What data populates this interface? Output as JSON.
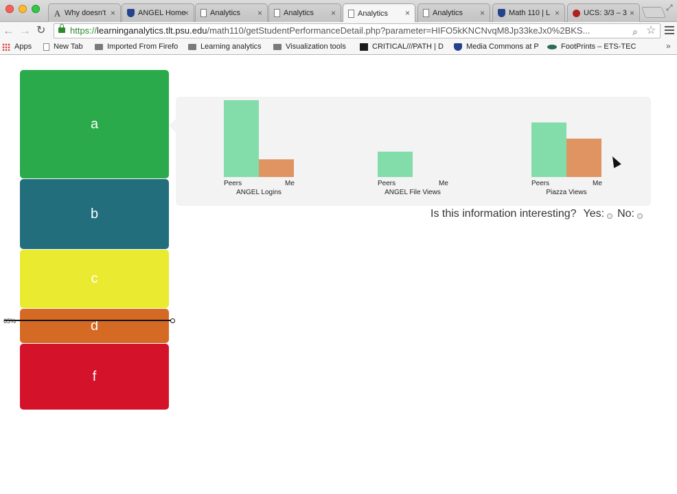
{
  "browser": {
    "tabs": [
      {
        "label": "Why doesn't",
        "icon": "letter-a-icon",
        "close": "×"
      },
      {
        "label": "ANGEL Home",
        "icon": "shield-icon",
        "close": "×"
      },
      {
        "label": "Analytics",
        "icon": "page-icon",
        "close": "×"
      },
      {
        "label": "Analytics",
        "icon": "page-icon",
        "close": "×"
      },
      {
        "label": "Analytics",
        "icon": "page-icon",
        "close": "×",
        "active": true
      },
      {
        "label": "Analytics",
        "icon": "page-icon",
        "close": "×"
      },
      {
        "label": "Math 110 | L",
        "icon": "shield-icon",
        "close": "×"
      },
      {
        "label": "UCS: 3/3 – 3",
        "icon": "ucs-icon",
        "close": "×"
      }
    ],
    "url_scheme": "https://",
    "url_host": "learninganalytics.tlt.psu.edu",
    "url_path": "/math110/getStudentPerformanceDetail.php?parameter=HIFO5kKNCNvqM8Jp33keJx0%2BKS...",
    "bookmarks": [
      {
        "label": "Apps",
        "icon": "apps-grid-icon"
      },
      {
        "label": "New Tab",
        "icon": "page-icon"
      },
      {
        "label": "Imported From Firefo",
        "icon": "folder-icon"
      },
      {
        "label": "Learning analytics",
        "icon": "folder-icon"
      },
      {
        "label": "Visualization tools",
        "icon": "folder-icon"
      },
      {
        "label": "CRITICAL///PATH | D",
        "icon": "critical-path-icon"
      },
      {
        "label": "Media Commons at P",
        "icon": "shield-icon"
      },
      {
        "label": "FootPrints – ETS-TEC",
        "icon": "footprints-icon"
      }
    ],
    "bookmarks_more": "»"
  },
  "grades": [
    {
      "label": "a",
      "color": "#2aaa4a"
    },
    {
      "label": "b",
      "color": "#226e7c"
    },
    {
      "label": "c",
      "color": "#eaea30"
    },
    {
      "label": "d",
      "color": "#d46a24"
    },
    {
      "label": "f",
      "color": "#d4132b"
    }
  ],
  "cutoff": {
    "label": "65%",
    "value_percent": 65
  },
  "chart_data": {
    "type": "bar",
    "series_colors": {
      "Peers": "#82ddaa",
      "Me": "#df9462"
    },
    "groups": [
      {
        "metric": "ANGEL Logins",
        "categories": [
          "Peers",
          "Me"
        ],
        "values": [
          100,
          23
        ]
      },
      {
        "metric": "ANGEL File Views",
        "categories": [
          "Peers",
          "Me"
        ],
        "values": [
          33,
          0
        ]
      },
      {
        "metric": "Piazza Views",
        "categories": [
          "Peers",
          "Me"
        ],
        "values": [
          71,
          50
        ]
      }
    ],
    "ylim": [
      0,
      100
    ],
    "grid": false
  },
  "feedback": {
    "question": "Is this information interesting?",
    "yes_label": "Yes:",
    "no_label": "No:"
  }
}
